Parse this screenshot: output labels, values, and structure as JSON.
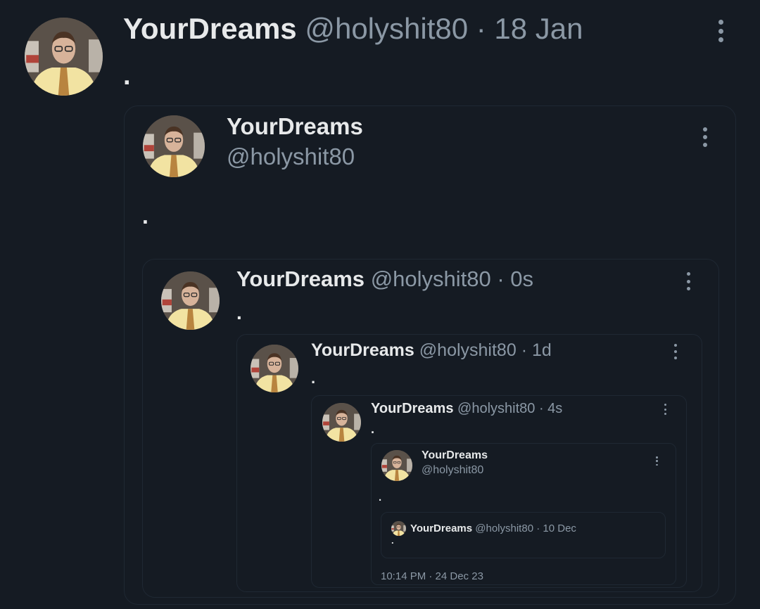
{
  "colors": {
    "background": "#151b23",
    "text_primary": "#e7e9ea",
    "text_secondary": "#8b98a5",
    "border": "#1f2833"
  },
  "icons": {
    "more": "vertical-ellipsis",
    "avatar": "profile-photo-man-in-yellow-shirt-and-tie"
  },
  "level1": {
    "name": "YourDreams",
    "handle": "@holyshit80",
    "time": "· 18 Jan",
    "body": "."
  },
  "level2": {
    "name": "YourDreams",
    "handle": "@holyshit80",
    "body": "."
  },
  "level3": {
    "name": "YourDreams",
    "handle": "@holyshit80",
    "time": "· 0s",
    "body": "."
  },
  "level4": {
    "name": "YourDreams",
    "handle": "@holyshit80",
    "time": "· 1d",
    "body": "."
  },
  "level5": {
    "name": "YourDreams",
    "handle": "@holyshit80",
    "time": "· 4s",
    "body": "."
  },
  "level6": {
    "name": "YourDreams",
    "handle": "@holyshit80",
    "body": ".",
    "timestamp": "10:14 PM · 24 Dec 23"
  },
  "level7": {
    "name": "YourDreams",
    "handle": "@holyshit80",
    "time": "· 10 Dec",
    "body": "."
  }
}
